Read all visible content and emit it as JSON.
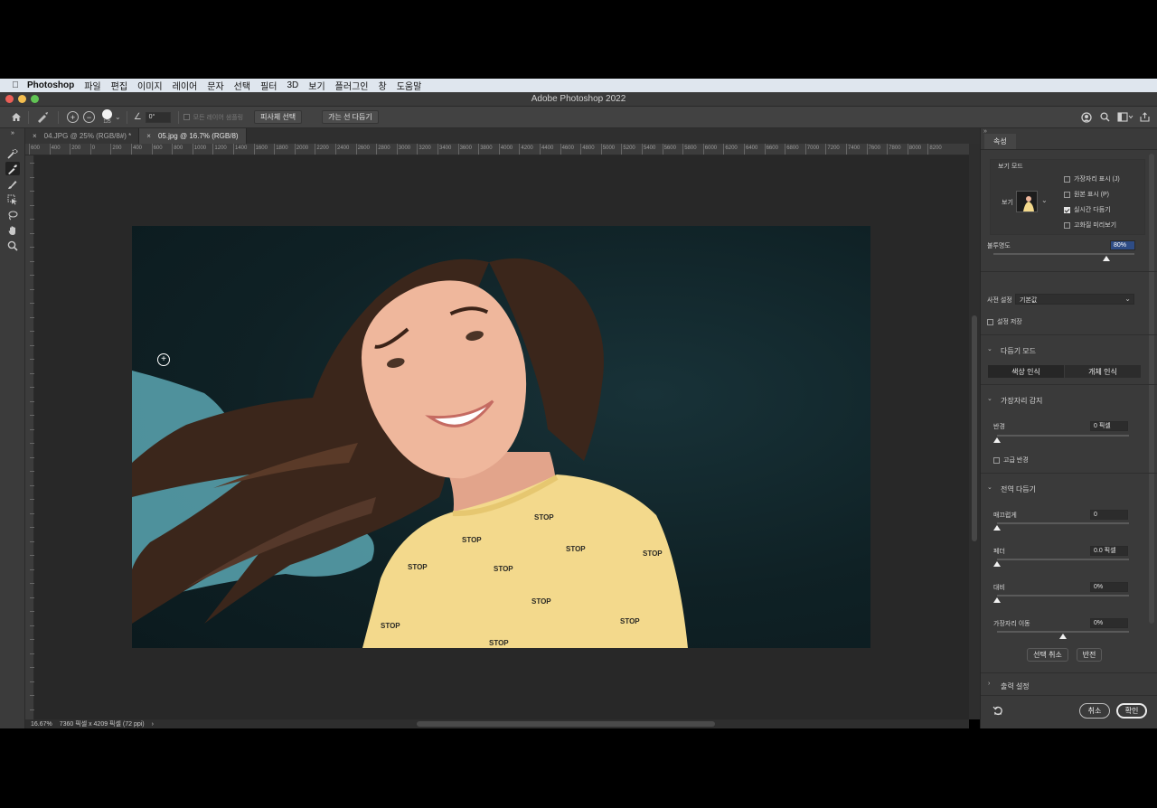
{
  "menubar": {
    "apple_icon": "apple-icon",
    "app_name": "Photoshop",
    "items": [
      "파일",
      "편집",
      "이미지",
      "레이어",
      "문자",
      "선택",
      "필터",
      "3D",
      "보기",
      "플러그인",
      "창",
      "도움말"
    ]
  },
  "window": {
    "title": "Adobe Photoshop 2022",
    "traffic_lights": [
      "#ec5f57",
      "#f4be4f",
      "#61c454"
    ]
  },
  "options_bar": {
    "brush_size": "125",
    "angle_value": "0°",
    "sample_all_layers": "모든 레이어 샘플링",
    "select_subject_button": "피사체 선택",
    "refine_hair_button": "가는 선 다듬기"
  },
  "tabs": [
    {
      "label": "04.JPG @ 25% (RGB/8#) *",
      "active": false
    },
    {
      "label": "05.jpg @ 16.7% (RGB/8)",
      "active": true
    }
  ],
  "ruler_labels": [
    "600",
    "400",
    "200",
    "0",
    "200",
    "400",
    "600",
    "800",
    "1000",
    "1200",
    "1400",
    "1600",
    "1800",
    "2000",
    "2200",
    "2400",
    "2600",
    "2800",
    "3000",
    "3200",
    "3400",
    "3600",
    "3800",
    "4000",
    "4200",
    "4400",
    "4600",
    "4800",
    "5000",
    "5200",
    "5400",
    "5600",
    "5800",
    "6000",
    "6200",
    "6400",
    "6600",
    "6800",
    "7000",
    "7200",
    "7400",
    "7600",
    "7800",
    "8000",
    "8200"
  ],
  "status": {
    "zoom": "16.67%",
    "doc_info": "7360 픽셀 x 4209 픽셀 (72 ppi)",
    "arrow": "›"
  },
  "panel": {
    "tab_label": "속성",
    "view_mode": {
      "title": "보기 모드",
      "view_label": "보기",
      "options": [
        {
          "label": "가장자리 표시 (J)",
          "checked": false
        },
        {
          "label": "원본 표시 (P)",
          "checked": false
        },
        {
          "label": "실시간 다듬기",
          "checked": true
        },
        {
          "label": "고화질 미리보기",
          "checked": false
        }
      ]
    },
    "opacity": {
      "label": "불투명도",
      "value": "80%",
      "level": 0.8
    },
    "preset": {
      "label": "사전 설정",
      "value": "기본값",
      "save_label": "설정 저장"
    },
    "refine_mode": {
      "title": "다듬기 모드",
      "options": [
        "색상 인식",
        "개체 인식"
      ]
    },
    "edge_detection": {
      "title": "가장자리 감지",
      "radius_label": "반경",
      "radius_value": "0 픽셀",
      "radius_level": 0,
      "smart_radius_label": "고급 반경"
    },
    "global_refinements": {
      "title": "전역 다듬기",
      "sliders": [
        {
          "label": "매끄럽게",
          "value": "0",
          "level": 0
        },
        {
          "label": "페더",
          "value": "0.0 픽셀",
          "level": 0
        },
        {
          "label": "대비",
          "value": "0%",
          "level": 0
        },
        {
          "label": "가장자리 이동",
          "value": "0%",
          "level": 0.5
        }
      ],
      "clear_selection": "선택 취소",
      "invert": "반전"
    },
    "output": {
      "title": "출력 설정"
    },
    "cancel": "취소",
    "ok": "확인"
  }
}
